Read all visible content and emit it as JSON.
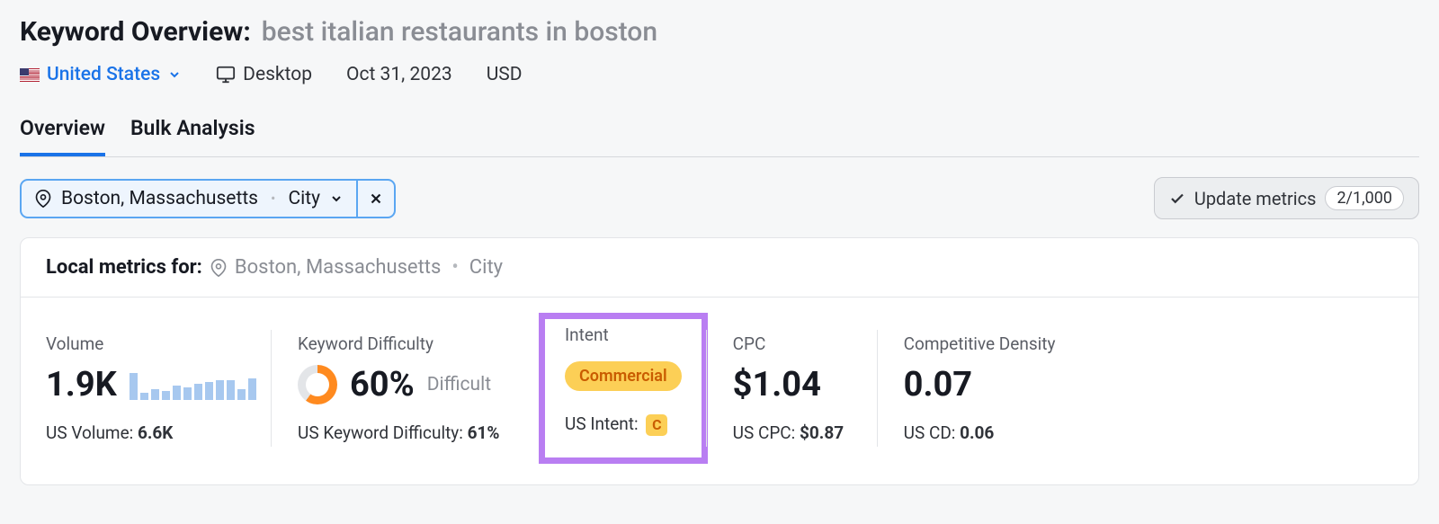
{
  "header": {
    "title_label": "Keyword Overview:",
    "keyword": "best italian restaurants in boston"
  },
  "filters": {
    "country": "United States",
    "device": "Desktop",
    "date": "Oct 31, 2023",
    "currency": "USD"
  },
  "tabs": {
    "overview": "Overview",
    "bulk": "Bulk Analysis"
  },
  "location_chip": {
    "place": "Boston, Massachusetts",
    "type": "City"
  },
  "update_button": {
    "label": "Update metrics",
    "count": "2/1,000"
  },
  "panel_header": {
    "prefix": "Local metrics for:",
    "place": "Boston, Massachusetts",
    "type": "City"
  },
  "metrics": {
    "volume": {
      "label": "Volume",
      "value": "1.9K",
      "sub_label": "US Volume: ",
      "sub_value": "6.6K"
    },
    "kd": {
      "label": "Keyword Difficulty",
      "value": "60%",
      "qualifier": "Difficult",
      "sub_label": "US Keyword Difficulty: ",
      "sub_value": "61%"
    },
    "intent": {
      "label": "Intent",
      "pill": "Commercial",
      "sub_label": "US Intent: ",
      "badge": "C"
    },
    "cpc": {
      "label": "CPC",
      "value": "$1.04",
      "sub_label": "US CPC: ",
      "sub_value": "$0.87"
    },
    "cd": {
      "label": "Competitive Density",
      "value": "0.07",
      "sub_label": "US CD: ",
      "sub_value": "0.06"
    }
  }
}
